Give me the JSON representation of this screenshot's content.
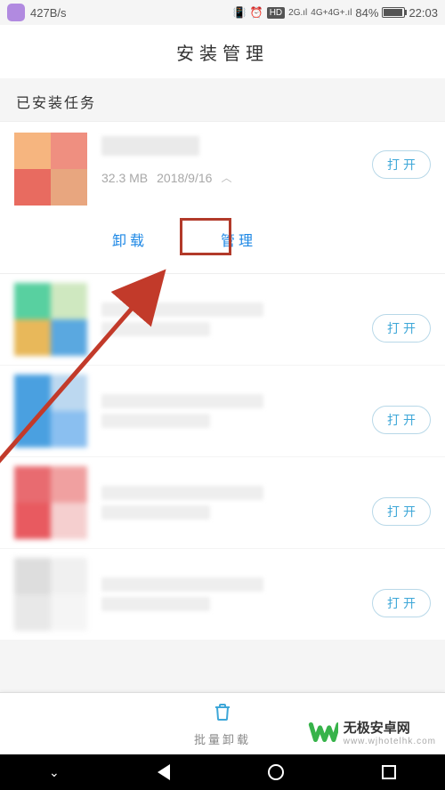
{
  "statusbar": {
    "speed": "427B/s",
    "hd_label": "HD",
    "sig2g_label": "2G",
    "sig4g_label": "4G+4G+",
    "battery_pct": "84%",
    "time": "22:03",
    "battery_fill_width": "84%"
  },
  "header": {
    "title": "安装管理"
  },
  "section": {
    "installed_label": "已安装任务"
  },
  "apps": [
    {
      "size": "32.3 MB",
      "date": "2018/9/16",
      "open_label": "打开",
      "expanded": true,
      "icon_colors": [
        "#f6b57f",
        "#ef8f80",
        "#e86b60",
        "#e8a67f"
      ]
    },
    {
      "open_label": "打开",
      "icon_colors": [
        "#58d0a0",
        "#cfe8c0",
        "#e8b85a",
        "#5aa8e0"
      ]
    },
    {
      "open_label": "打开",
      "icon_colors": [
        "#4aa0e0",
        "#bcd8f0",
        "#4aa0e0",
        "#8abff0"
      ]
    },
    {
      "open_label": "打开",
      "icon_colors": [
        "#e86b70",
        "#f0a0a0",
        "#e85a60",
        "#f5cfcf"
      ]
    },
    {
      "open_label": "打开",
      "icon_colors": [
        "#dddddd",
        "#f0f0f0",
        "#e8e8e8",
        "#f5f5f5"
      ]
    }
  ],
  "actions": {
    "uninstall_label": "卸载",
    "manage_label": "管理"
  },
  "bottombar": {
    "batch_uninstall_label": "批量卸载"
  },
  "watermark": {
    "name": "无极安卓网",
    "url": "www.wjhotelhk.com"
  }
}
